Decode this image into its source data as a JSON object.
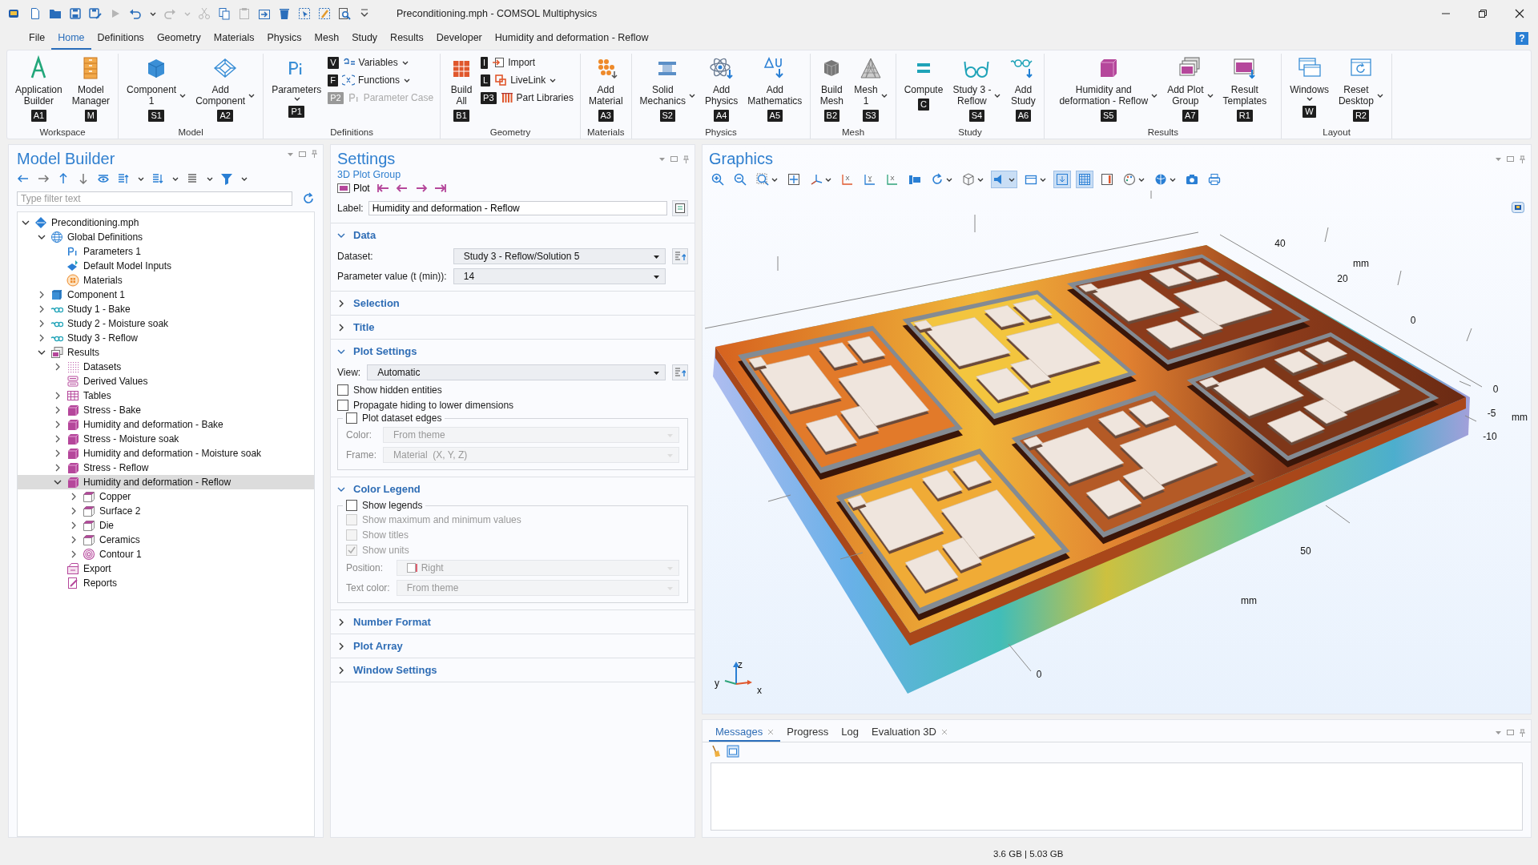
{
  "window": {
    "title": "Preconditioning.mph - COMSOL Multiphysics"
  },
  "quick_access": [
    {
      "disabled": false
    },
    {
      "disabled": false
    },
    {
      "disabled": false
    },
    {
      "disabled": false
    },
    {
      "disabled": true
    },
    {
      "disabled": false
    },
    {
      "disabled": true
    },
    {
      "disabled": true
    },
    {
      "disabled": false
    },
    {
      "disabled": true
    },
    {
      "disabled": false
    },
    {
      "disabled": false
    },
    {
      "disabled": false
    },
    {
      "disabled": false
    },
    {
      "disabled": false
    },
    {
      "disabled": false
    }
  ],
  "menu_tabs": [
    {
      "label": "File",
      "selected": false
    },
    {
      "label": "Home",
      "selected": true
    },
    {
      "label": "Definitions",
      "selected": false
    },
    {
      "label": "Geometry",
      "selected": false
    },
    {
      "label": "Materials",
      "selected": false
    },
    {
      "label": "Physics",
      "selected": false
    },
    {
      "label": "Mesh",
      "selected": false
    },
    {
      "label": "Study",
      "selected": false
    },
    {
      "label": "Results",
      "selected": false
    },
    {
      "label": "Developer",
      "selected": false
    },
    {
      "label": "Humidity and deformation - Reflow",
      "selected": false
    }
  ],
  "help": "?",
  "ribbon": {
    "groups": [
      {
        "label": "Workspace",
        "buttons": [
          {
            "kind": "large",
            "label": "Application\nBuilder",
            "key": "A1",
            "dropdown": false,
            "disabled": false
          },
          {
            "kind": "large",
            "label": "Model\nManager",
            "key": "M",
            "dropdown": false,
            "disabled": false
          }
        ]
      },
      {
        "label": "Model",
        "buttons": [
          {
            "kind": "large",
            "label": "Component\n1",
            "key": "S1",
            "dropdown": true,
            "disabled": false
          },
          {
            "kind": "large",
            "label": "Add\nComponent",
            "key": "A2",
            "dropdown": true,
            "disabled": false
          }
        ]
      },
      {
        "label": "Definitions",
        "buttons": [
          {
            "kind": "large",
            "label": "Parameters",
            "key": "P1",
            "dropdown": true,
            "disabled": false
          },
          {
            "kind": "small",
            "label": "Variables",
            "key": "V",
            "dropdown": true,
            "disabled": false
          },
          {
            "kind": "small",
            "label": "Functions",
            "key": "F",
            "dropdown": true,
            "disabled": false
          },
          {
            "kind": "small",
            "label": "Parameter Case",
            "key": "P2",
            "dropdown": false,
            "disabled": true
          }
        ]
      },
      {
        "label": "Geometry",
        "buttons": [
          {
            "kind": "large",
            "label": "Build\nAll",
            "key": "B1",
            "dropdown": false,
            "disabled": false
          },
          {
            "kind": "small",
            "label": "Import",
            "key": "I",
            "dropdown": false,
            "disabled": false
          },
          {
            "kind": "small",
            "label": "LiveLink",
            "key": "L",
            "dropdown": true,
            "disabled": false
          },
          {
            "kind": "small",
            "label": "Part Libraries",
            "key": "P3",
            "dropdown": false,
            "disabled": false
          }
        ]
      },
      {
        "label": "Materials",
        "buttons": [
          {
            "kind": "large",
            "label": "Add\nMaterial",
            "key": "A3",
            "dropdown": false,
            "disabled": false
          }
        ]
      },
      {
        "label": "Physics",
        "buttons": [
          {
            "kind": "large",
            "label": "Solid\nMechanics",
            "key": "S2",
            "dropdown": true,
            "disabled": false
          },
          {
            "kind": "large",
            "label": "Add\nPhysics",
            "key": "A4",
            "dropdown": false,
            "disabled": false
          },
          {
            "kind": "large",
            "label": "Add\nMathematics",
            "key": "A5",
            "dropdown": false,
            "disabled": false
          }
        ]
      },
      {
        "label": "Mesh",
        "buttons": [
          {
            "kind": "large",
            "label": "Build\nMesh",
            "key": "B2",
            "dropdown": false,
            "disabled": false
          },
          {
            "kind": "large",
            "label": "Mesh\n1",
            "key": "S3",
            "dropdown": true,
            "disabled": false
          }
        ]
      },
      {
        "label": "Study",
        "buttons": [
          {
            "kind": "large",
            "label": "Compute",
            "key": "C",
            "dropdown": false,
            "disabled": false
          },
          {
            "kind": "large",
            "label": "Study 3 -\nReflow",
            "key": "S4",
            "dropdown": true,
            "disabled": false
          },
          {
            "kind": "large",
            "label": "Add\nStudy",
            "key": "A6",
            "dropdown": false,
            "disabled": false
          }
        ]
      },
      {
        "label": "Results",
        "buttons": [
          {
            "kind": "large",
            "label": "Humidity and\ndeformation - Reflow",
            "key": "S5",
            "dropdown": true,
            "disabled": false
          },
          {
            "kind": "large",
            "label": "Add Plot\nGroup",
            "key": "A7",
            "dropdown": true,
            "disabled": false
          },
          {
            "kind": "large",
            "label": "Result\nTemplates",
            "key": "R1",
            "dropdown": false,
            "disabled": false
          }
        ]
      },
      {
        "label": "Layout",
        "buttons": [
          {
            "kind": "large",
            "label": "Windows",
            "key": "W",
            "dropdown": true,
            "disabled": false
          },
          {
            "kind": "large",
            "label": "Reset\nDesktop",
            "key": "R2",
            "dropdown": true,
            "disabled": false
          }
        ]
      }
    ]
  },
  "model_builder": {
    "title": "Model Builder",
    "filter": {
      "placeholder": "Type filter text"
    },
    "tree": [
      {
        "label": "Preconditioning.mph",
        "kind": "file",
        "expanded": true,
        "selected": false,
        "children": [
          {
            "label": "Global Definitions",
            "kind": "globe",
            "expanded": true,
            "selected": false,
            "children": [
              {
                "label": "Parameters 1",
                "kind": "parameters",
                "selected": false
              },
              {
                "label": "Default Model Inputs",
                "kind": "inputs",
                "selected": false
              },
              {
                "label": "Materials",
                "kind": "materials",
                "selected": false
              }
            ]
          },
          {
            "label": "Component 1",
            "kind": "component",
            "expanded": false,
            "selected": false
          },
          {
            "label": "Study 1 - Bake",
            "kind": "study",
            "expanded": false,
            "selected": false
          },
          {
            "label": "Study 2 - Moisture soak",
            "kind": "study",
            "expanded": false,
            "selected": false
          },
          {
            "label": "Study 3 - Reflow",
            "kind": "study",
            "expanded": false,
            "selected": false
          },
          {
            "label": "Results",
            "kind": "results",
            "expanded": true,
            "selected": false,
            "children": [
              {
                "label": "Datasets",
                "kind": "datasets",
                "expanded": false,
                "selected": false
              },
              {
                "label": "Derived Values",
                "kind": "derived",
                "selected": false
              },
              {
                "label": "Tables",
                "kind": "table",
                "expanded": false,
                "selected": false
              },
              {
                "label": "Stress - Bake",
                "kind": "plotgroup",
                "expanded": false,
                "selected": false
              },
              {
                "label": "Humidity and deformation - Bake",
                "kind": "plotgroup",
                "expanded": false,
                "selected": false
              },
              {
                "label": "Stress - Moisture soak",
                "kind": "plotgroup",
                "expanded": false,
                "selected": false
              },
              {
                "label": "Humidity and deformation - Moisture soak",
                "kind": "plotgroup",
                "expanded": false,
                "selected": false
              },
              {
                "label": "Stress - Reflow",
                "kind": "plotgroup",
                "expanded": false,
                "selected": false
              },
              {
                "label": "Humidity and deformation - Reflow",
                "kind": "plotgroup",
                "expanded": true,
                "selected": true,
                "children": [
                  {
                    "label": "Copper",
                    "kind": "plot",
                    "expanded": false,
                    "selected": false
                  },
                  {
                    "label": "Surface 2",
                    "kind": "plot",
                    "expanded": false,
                    "selected": false
                  },
                  {
                    "label": "Die",
                    "kind": "plot",
                    "expanded": false,
                    "selected": false
                  },
                  {
                    "label": "Ceramics",
                    "kind": "plot",
                    "expanded": false,
                    "selected": false
                  },
                  {
                    "label": "Contour 1",
                    "kind": "contour",
                    "expanded": false,
                    "selected": false
                  }
                ]
              },
              {
                "label": "Export",
                "kind": "export",
                "selected": false
              },
              {
                "label": "Reports",
                "kind": "report",
                "selected": false
              }
            ]
          }
        ]
      }
    ]
  },
  "settings": {
    "title": "Settings",
    "subtitle": "3D Plot Group",
    "plot_button": "Plot",
    "label_field": {
      "label": "Label:",
      "value": "Humidity and deformation - Reflow"
    },
    "sections": [
      {
        "title": "Data",
        "expanded": true,
        "rows": [
          {
            "kind": "select",
            "label": "Dataset:",
            "value": "Study 3 - Reflow/Solution 5",
            "disabled": false,
            "button": true
          },
          {
            "kind": "select",
            "label": "Parameter value (t (min)):",
            "value": "14",
            "disabled": false
          }
        ]
      },
      {
        "title": "Selection",
        "expanded": false
      },
      {
        "title": "Title",
        "expanded": false
      },
      {
        "title": "Plot Settings",
        "expanded": true,
        "rows": [
          {
            "kind": "select",
            "label": "View:",
            "value": "Automatic",
            "disabled": false,
            "button": true
          },
          {
            "kind": "checkbox",
            "label": "Show hidden entities",
            "checked": false,
            "disabled": false
          },
          {
            "kind": "checkbox",
            "label": "Propagate hiding to lower dimensions",
            "checked": false,
            "disabled": false
          },
          {
            "kind": "group",
            "header": {
              "label": "Plot dataset edges",
              "checked": false,
              "disabled": false
            },
            "rows": [
              {
                "kind": "select",
                "label": "Color:",
                "value": "From theme",
                "disabled": true
              },
              {
                "kind": "select",
                "label": "Frame:",
                "value": "Material  (X, Y, Z)",
                "disabled": true
              }
            ]
          }
        ]
      },
      {
        "title": "Color Legend",
        "expanded": true,
        "rows": [
          {
            "kind": "group",
            "header": {
              "label": "Show legends",
              "checked": false,
              "disabled": false
            },
            "rows": [
              {
                "kind": "checkbox",
                "label": "Show maximum and minimum values",
                "checked": false,
                "disabled": true
              },
              {
                "kind": "checkbox",
                "label": "Show titles",
                "checked": false,
                "disabled": true
              },
              {
                "kind": "checkbox",
                "label": "Show units",
                "checked": true,
                "disabled": true
              },
              {
                "kind": "select",
                "label": "Position:",
                "value": "Right",
                "disabled": true,
                "swatch": true
              },
              {
                "kind": "select",
                "label": "Text color:",
                "value": "From theme",
                "disabled": true
              }
            ]
          }
        ]
      },
      {
        "title": "Number Format",
        "expanded": false
      },
      {
        "title": "Plot Array",
        "expanded": false
      },
      {
        "title": "Window Settings",
        "expanded": false
      }
    ]
  },
  "graphics": {
    "title": "Graphics",
    "toolbar": [
      {
        "on": false
      },
      {
        "on": false
      },
      {
        "on": false
      },
      {
        "on": false
      },
      {
        "on": false
      },
      {
        "on": false
      },
      {
        "on": false
      },
      {
        "on": false
      },
      {
        "on": false
      },
      {
        "on": false
      },
      {
        "on": false
      },
      {
        "on": true
      },
      {
        "on": false
      },
      {
        "on": true
      },
      {
        "on": true
      },
      {
        "on": false
      },
      {
        "on": false
      },
      {
        "on": false
      },
      {
        "on": false
      },
      {
        "on": false
      }
    ],
    "axis_labels": [
      "40",
      "mm",
      "20",
      "0",
      "0",
      "-5",
      "mm",
      "-10",
      "50",
      "mm",
      "0"
    ],
    "triad": [
      "z",
      "y",
      "x"
    ]
  },
  "messages": {
    "tabs": [
      {
        "label": "Messages",
        "selected": true,
        "closable": true
      },
      {
        "label": "Progress",
        "selected": false,
        "closable": false
      },
      {
        "label": "Log",
        "selected": false,
        "closable": false
      },
      {
        "label": "Evaluation 3D",
        "selected": false,
        "closable": true
      }
    ]
  },
  "status_bar": {
    "memory": "3.6 GB | 5.03 GB"
  }
}
